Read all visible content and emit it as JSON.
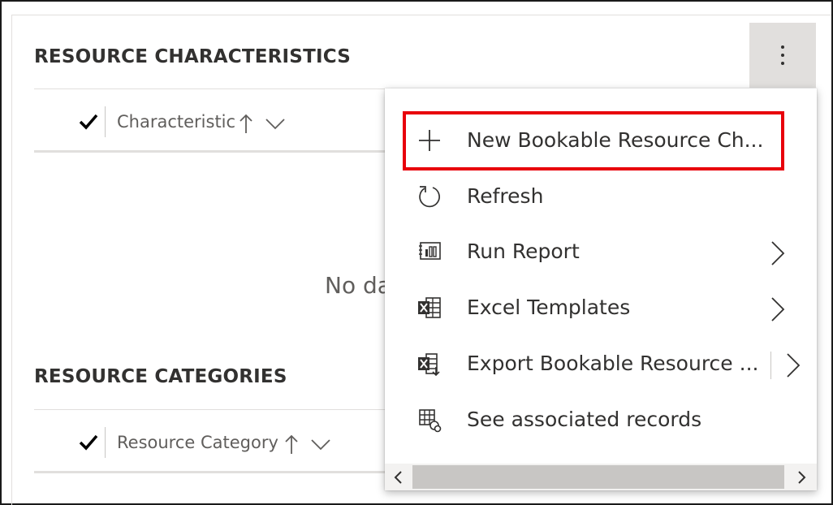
{
  "sections": {
    "characteristics": {
      "title": "RESOURCE CHARACTERISTICS",
      "column_label": "Characteristic",
      "empty_text": "No da"
    },
    "categories": {
      "title": "RESOURCE CATEGORIES",
      "column_label": "Resource Category"
    }
  },
  "more_button": {
    "icon": "more-vertical-icon"
  },
  "menu": {
    "items": [
      {
        "label": "New Bookable Resource Ch...",
        "icon": "plus-icon",
        "highlighted": true
      },
      {
        "label": "Refresh",
        "icon": "refresh-icon"
      },
      {
        "label": "Run Report",
        "icon": "report-icon",
        "has_submenu": true
      },
      {
        "label": "Excel Templates",
        "icon": "excel-template-icon",
        "has_submenu": true
      },
      {
        "label": "Export Bookable Resource ...",
        "icon": "excel-export-icon",
        "has_submenu": true,
        "split": true
      },
      {
        "label": "See associated records",
        "icon": "associated-records-icon"
      }
    ]
  },
  "colors": {
    "highlight": "#e8000b",
    "more_button_bg": "#e1dfdd",
    "text": "#323130",
    "muted_text": "#605e5c"
  }
}
